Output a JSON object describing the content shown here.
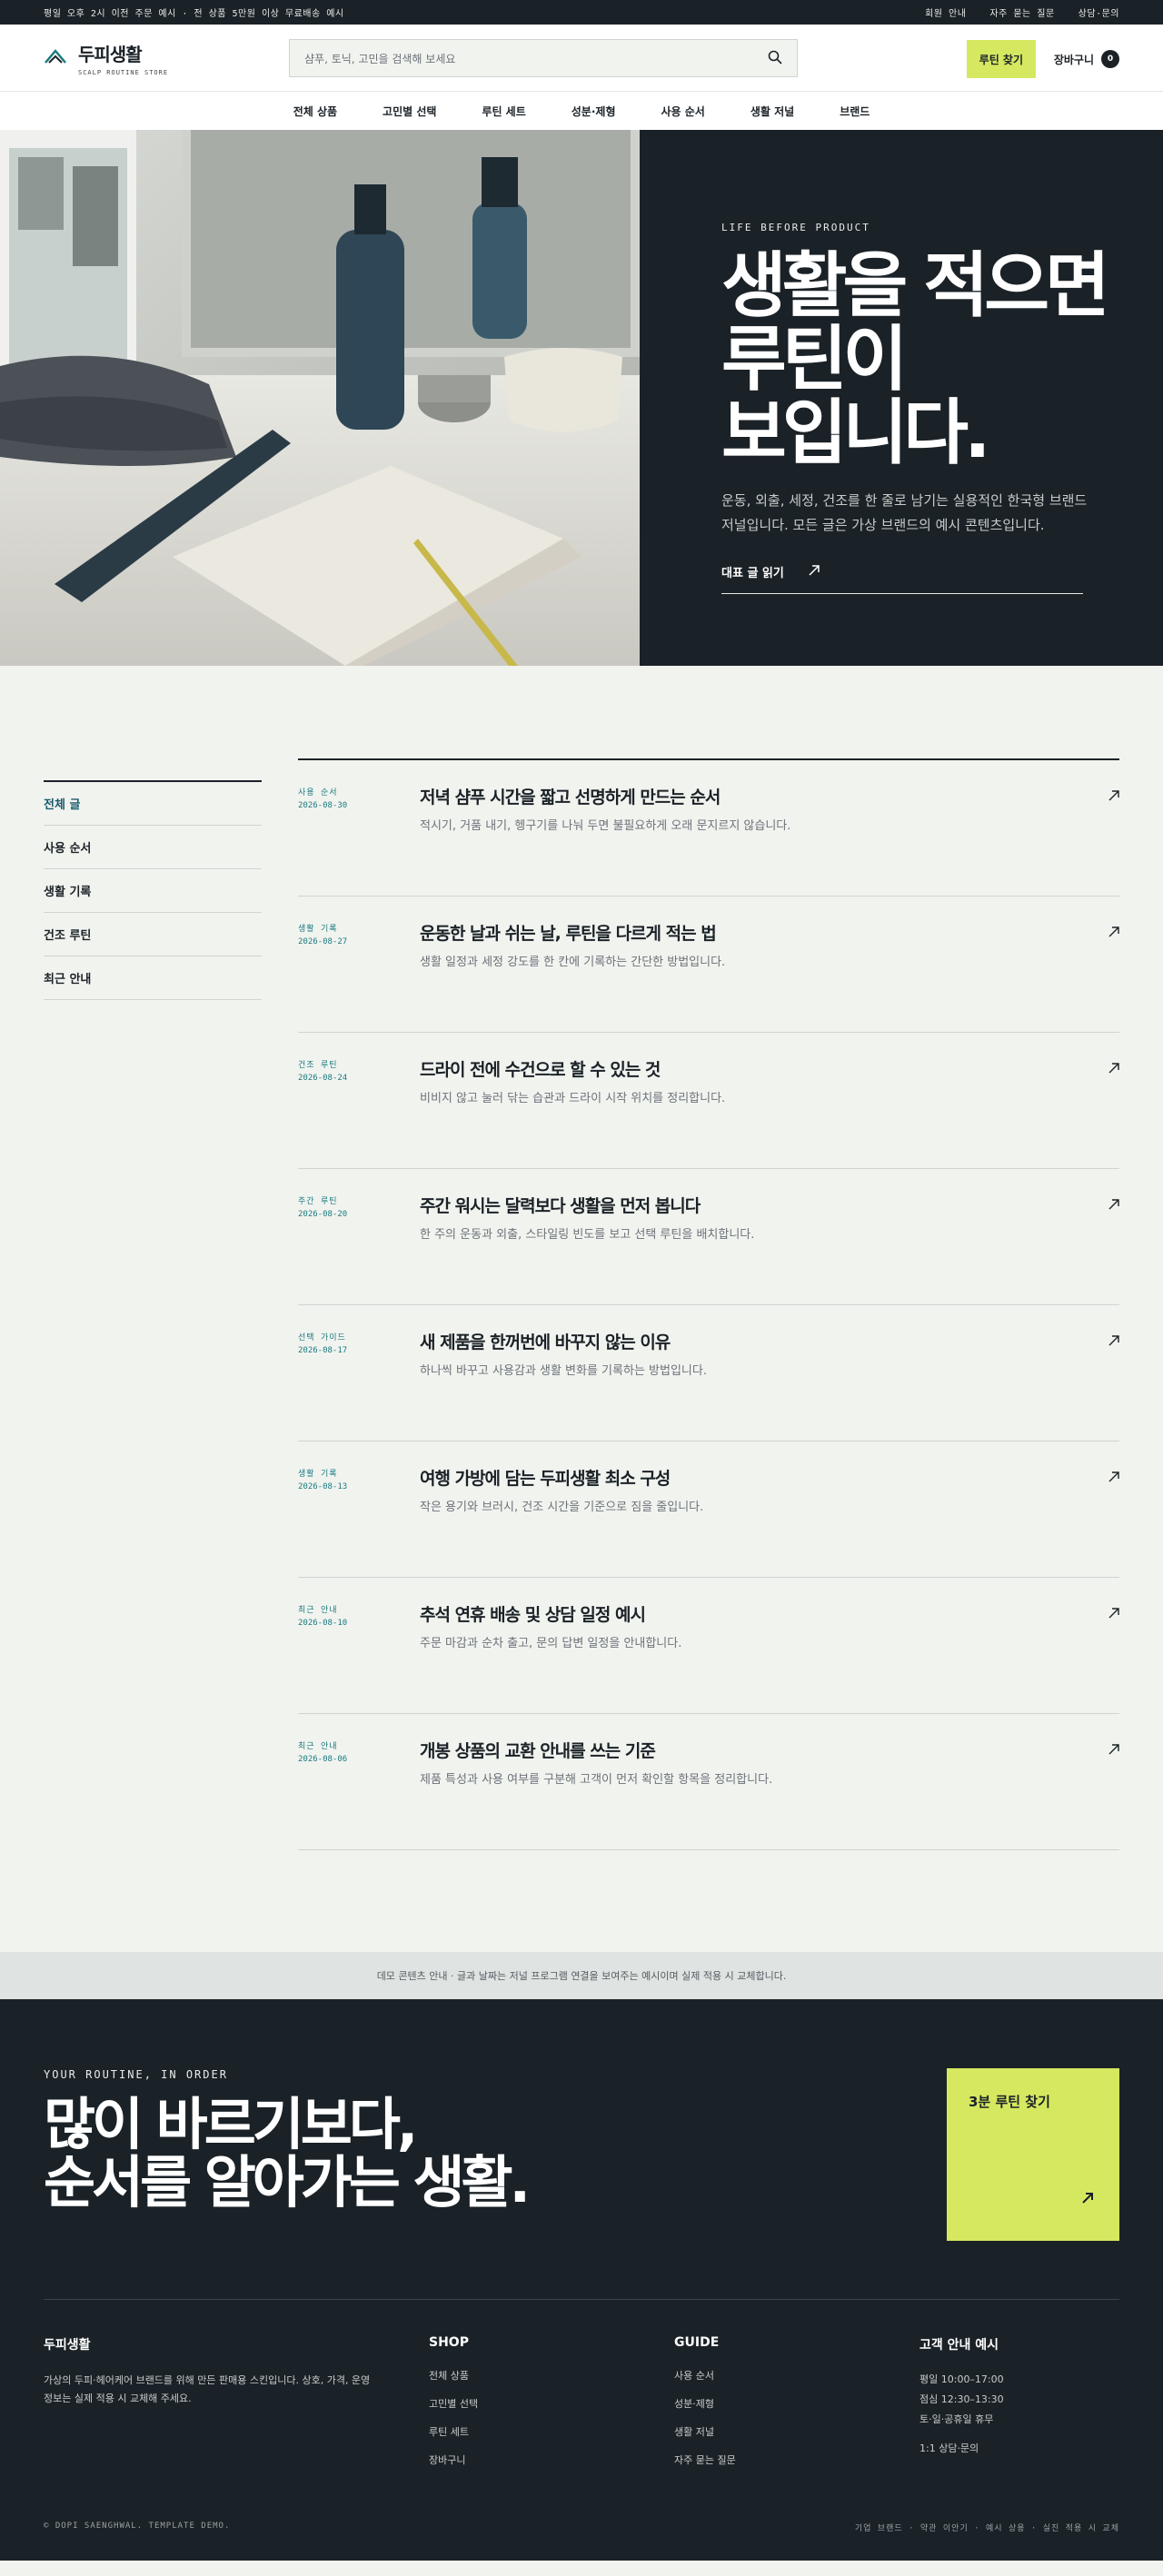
{
  "topbar": {
    "notice": "평일 오후 2시 이전 주문 예시 · 전 상품 5만원 이상 무료배송 예시",
    "links": [
      "회원 안내",
      "자주 묻는 질문",
      "상담·문의"
    ]
  },
  "header": {
    "logo_name": "두피생활",
    "logo_sub": "SCALP ROUTINE STORE",
    "search_placeholder": "샴푸, 토닉, 고민을 검색해 보세요",
    "routine_button": "루틴 찾기",
    "cart_label": "장바구니",
    "cart_count": "0"
  },
  "nav": {
    "items": [
      "전체 상품",
      "고민별 선택",
      "루틴 세트",
      "성분·제형",
      "사용 순서",
      "생활 저널",
      "브랜드"
    ]
  },
  "hero": {
    "eyebrow": "LIFE BEFORE PRODUCT",
    "title_lines": [
      "생활을 적으면",
      "루틴이",
      "보입니다."
    ],
    "description": "운동, 외출, 세정, 건조를 한 줄로 남기는 실용적인 한국형 브랜드 저널입니다. 모든 글은 가상 브랜드의 예시 콘텐츠입니다.",
    "link": "대표 글 읽기"
  },
  "sidebar": {
    "items": [
      "전체 글",
      "사용 순서",
      "생활 기록",
      "건조 루틴",
      "최근 안내"
    ],
    "active": 0
  },
  "articles": [
    {
      "category": "사용 순서",
      "date": "2026-08-30",
      "title": "저녁 샴푸 시간을 짧고 선명하게 만드는 순서",
      "desc": "적시기, 거품 내기, 헹구기를 나눠 두면 불필요하게 오래 문지르지 않습니다."
    },
    {
      "category": "생활 기록",
      "date": "2026-08-27",
      "title": "운동한 날과 쉬는 날, 루틴을 다르게 적는 법",
      "desc": "생활 일정과 세정 강도를 한 칸에 기록하는 간단한 방법입니다."
    },
    {
      "category": "건조 루틴",
      "date": "2026-08-24",
      "title": "드라이 전에 수건으로 할 수 있는 것",
      "desc": "비비지 않고 눌러 닦는 습관과 드라이 시작 위치를 정리합니다."
    },
    {
      "category": "주간 루틴",
      "date": "2026-08-20",
      "title": "주간 워시는 달력보다 생활을 먼저 봅니다",
      "desc": "한 주의 운동과 외출, 스타일링 빈도를 보고 선택 루틴을 배치합니다."
    },
    {
      "category": "선택 가이드",
      "date": "2026-08-17",
      "title": "새 제품을 한꺼번에 바꾸지 않는 이유",
      "desc": "하나씩 바꾸고 사용감과 생활 변화를 기록하는 방법입니다."
    },
    {
      "category": "생활 기록",
      "date": "2026-08-13",
      "title": "여행 가방에 담는 두피생활 최소 구성",
      "desc": "작은 용기와 브러시, 건조 시간을 기준으로 짐을 줄입니다."
    },
    {
      "category": "최근 안내",
      "date": "2026-08-10",
      "title": "추석 연휴 배송 및 상담 일정 예시",
      "desc": "주문 마감과 순차 출고, 문의 답변 일정을 안내합니다."
    },
    {
      "category": "최근 안내",
      "date": "2026-08-06",
      "title": "개봉 상품의 교환 안내를 쓰는 기준",
      "desc": "제품 특성과 사용 여부를 구분해 고객이 먼저 확인할 항목을 정리합니다."
    }
  ],
  "notice_bar": "데모 콘텐츠 안내 · 글과 날짜는 저널 프로그램 연결을 보여주는 예시이며 실제 적용 시 교체합니다.",
  "footer": {
    "eyebrow": "YOUR ROUTINE, IN ORDER",
    "slogan_lines": [
      "많이 바르기보다,",
      "순서를 알아가는 생활."
    ],
    "cta": "3분 루틴 찾기",
    "brand_title": "두피생활",
    "brand_about": "가상의 두피·헤어케어 브랜드를 위해 만든 판매용 스킨입니다. 상호, 가격, 운영 정보는 실제 적용 시 교체해 주세요.",
    "shop_title": "SHOP",
    "shop_items": [
      "전체 상품",
      "고민별 선택",
      "루틴 세트",
      "장바구니"
    ],
    "guide_title": "GUIDE",
    "guide_items": [
      "사용 순서",
      "성분·제형",
      "생활 저널",
      "자주 묻는 질문"
    ],
    "cs_title": "고객 안내 예시",
    "cs_items": [
      "평일 10:00–17:00",
      "점심 12:30–13:30",
      "토·일·공휴일 휴무",
      "1:1 상담·문의"
    ],
    "copyright": "© DOPI SAENGHWAL. TEMPLATE DEMO.",
    "bottom_links": "기업 브랜드 · 약관 이안기 · 예시 상용 · 실진 적용 시 교체"
  },
  "colors": {
    "dark": "#1b2227",
    "accent": "#d6e860",
    "teal": "#1a7a80",
    "bg": "#f1f3ef"
  }
}
